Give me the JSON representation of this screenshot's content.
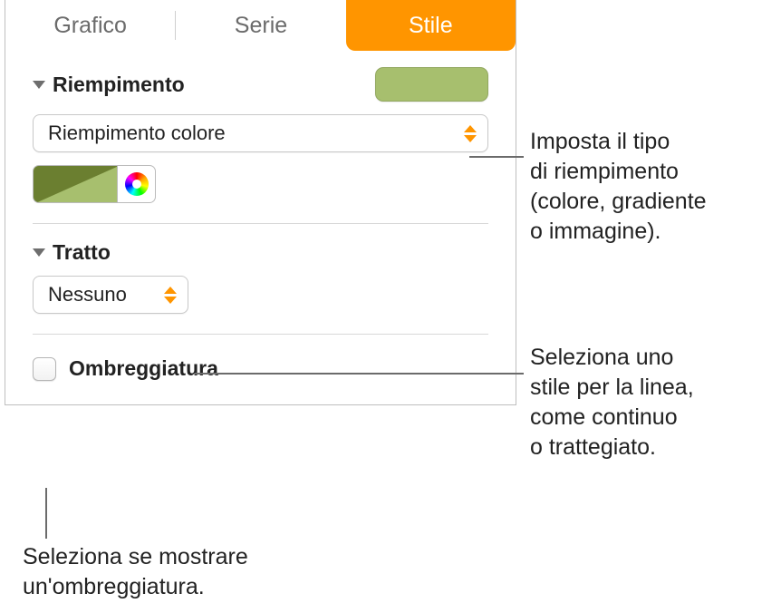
{
  "tabs": {
    "chart": "Grafico",
    "series": "Serie",
    "style": "Stile"
  },
  "fill": {
    "title": "Riempimento",
    "type": "Riempimento colore"
  },
  "stroke": {
    "title": "Tratto",
    "value": "Nessuno"
  },
  "shadow": {
    "label": "Ombreggiatura"
  },
  "callouts": {
    "fill": "Imposta il tipo\ndi riempimento\n(colore, gradiente\no immagine).",
    "stroke": "Seleziona uno\nstile per la linea,\ncome continuo\no trattegiato.",
    "shadow": "Seleziona se mostrare\nun'ombreggiatura."
  }
}
